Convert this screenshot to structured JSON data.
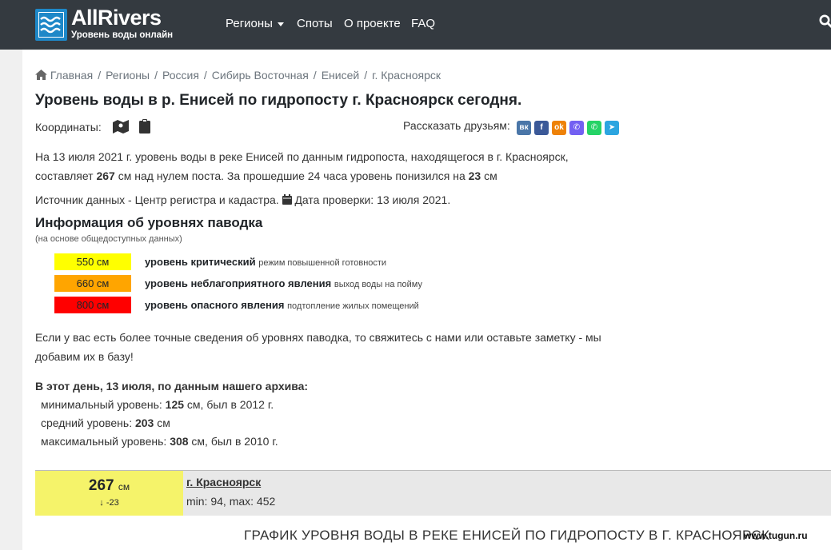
{
  "nav": {
    "logo_title": "AllRivers",
    "logo_sub": "Уровень воды онлайн",
    "items": [
      "Регионы",
      "Споты",
      "О проекте",
      "FAQ"
    ]
  },
  "breadcrumb": [
    "Главная",
    "Регионы",
    "Россия",
    "Сибирь Восточная",
    "Енисей",
    "г. Красноярск"
  ],
  "title": "Уровень воды в р. Енисей по гидропосту г. Красноярск сегодня.",
  "coords_label": "Координаты:",
  "share_label": "Рассказать друзьям:",
  "intro": {
    "part1": "На 13 июля 2021 г. уровень воды в реке Енисей по данным гидропоста, находящегося в г. Красноярск,",
    "part2a": "составляет ",
    "level": "267",
    "part2b": " см над нулем поста. За прошедшие 24 часа уровень понизился на ",
    "change": "23",
    "part2c": " см"
  },
  "source": {
    "text": "Источник данных - Центр регистра и кадастра.",
    "check": "Дата проверки: 13 июля 2021."
  },
  "flood": {
    "title": "Информация об уровнях паводка",
    "subtitle": "(на основе общедоступных данных)",
    "levels": [
      {
        "value": "550 см",
        "name": "уровень критический",
        "note": "режим повышенной готовности",
        "color": "#ffff00"
      },
      {
        "value": "660 см",
        "name": "уровень неблагоприятного явления",
        "note": "выход воды на пойму",
        "color": "#ffa500"
      },
      {
        "value": "800 см",
        "name": "уровень опасного явления",
        "note": "подтопление жилых помещений",
        "color": "#ff0000"
      }
    ]
  },
  "contact": {
    "line1": "Если у вас есть более точные сведения об уровнях паводка, то свяжитесь с нами или оставьте заметку - мы",
    "line2": "добавим их в базу!"
  },
  "archive": {
    "title": "В этот день, 13 июля, по данным нашего архива:",
    "min_pre": "минимальный уровень: ",
    "min_val": "125",
    "min_post": " см, был в 2012 г.",
    "avg_pre": "средний уровень: ",
    "avg_val": "203",
    "avg_post": " см",
    "max_pre": "максимальный уровень: ",
    "max_val": "308",
    "max_post": " см, был в 2010 г."
  },
  "gauge": {
    "value": "267",
    "unit": "см",
    "diff": "↓ -23",
    "name": "г. Красноярск",
    "minmax": "min: 94, max: 452"
  },
  "chart_title": "ГРАФИК УРОВНЯ ВОДЫ В РЕКЕ ЕНИСЕЙ ПО ГИДРОПОСТУ В Г. КРАСНОЯРСК",
  "watermark": "www.tugun.ru"
}
